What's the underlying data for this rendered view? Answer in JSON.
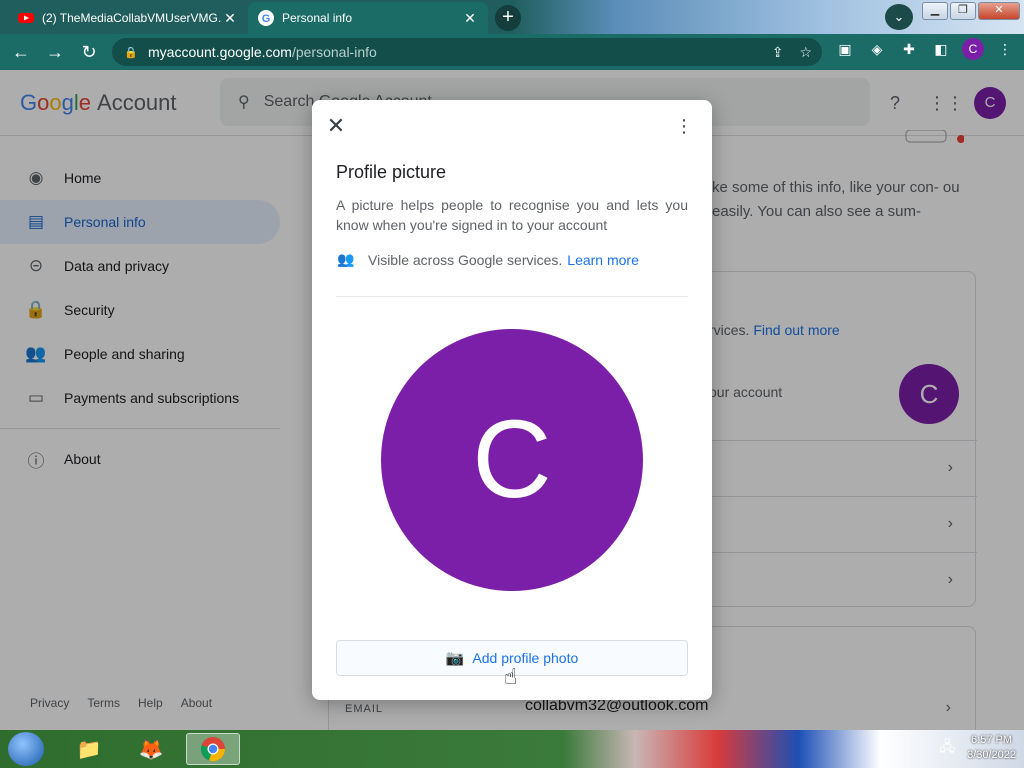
{
  "browser": {
    "tabs": [
      {
        "title": "(2) TheMediaCollabVMUserVMG...",
        "active": false
      },
      {
        "title": "Personal info",
        "active": true
      }
    ],
    "url_domain": "myaccount.google.com",
    "url_path": "/personal-info",
    "profile_initial": "C"
  },
  "header": {
    "logo_letters": [
      "G",
      "o",
      "o",
      "g",
      "l",
      "e"
    ],
    "logo_suffix": "Account",
    "search_placeholder": "Search Google Account",
    "profile_initial": "C"
  },
  "sidebar": {
    "items": [
      {
        "label": "Home",
        "icon": "home-icon"
      },
      {
        "label": "Personal info",
        "icon": "person-icon"
      },
      {
        "label": "Data and privacy",
        "icon": "toggle-icon"
      },
      {
        "label": "Security",
        "icon": "lock-icon"
      },
      {
        "label": "People and sharing",
        "icon": "people-icon"
      },
      {
        "label": "Payments and subscriptions",
        "icon": "card-icon"
      }
    ],
    "about": "About",
    "footer": [
      "Privacy",
      "Terms",
      "Help",
      "About"
    ]
  },
  "main": {
    "intro_text": "ke some of this info, like your con- ou easily. You can also see a sum-",
    "card_line1": "rvices.",
    "card_link": "Find out more",
    "card_line2": "our account",
    "card_avatar_initial": "C",
    "email_label": "EMAIL",
    "email_value": "collabvm32@outlook.com"
  },
  "dialog": {
    "title": "Profile picture",
    "description": "A picture helps people to recognise you and lets you know when you're signed in to your account",
    "visibility_text": "Visible across Google services.",
    "learn_more": "Learn more",
    "avatar_initial": "C",
    "add_button": "Add profile photo"
  },
  "taskbar": {
    "time": "6:57 PM",
    "date": "3/30/2022"
  },
  "colors": {
    "avatar": "#7c1fa8",
    "link": "#1a73e8",
    "chrome_teal": "#1b6b66"
  }
}
